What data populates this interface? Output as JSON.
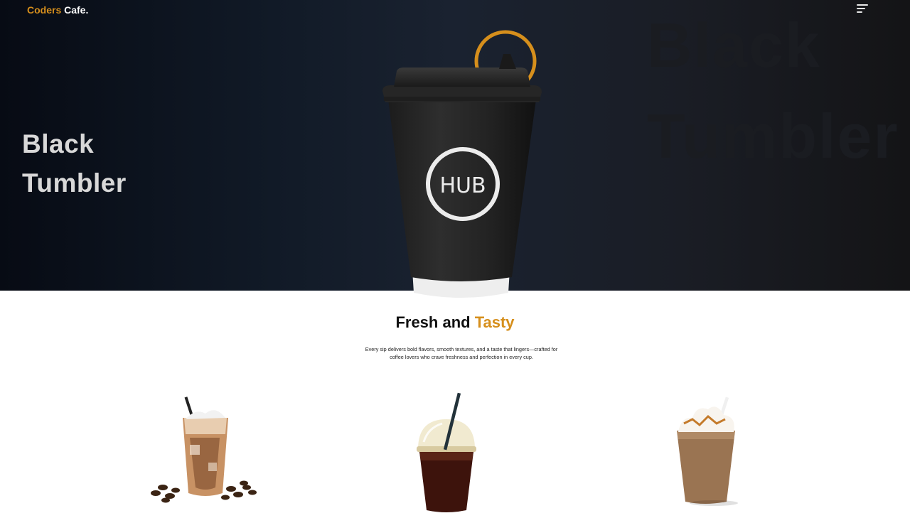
{
  "header": {
    "logo_first": "Coders",
    "logo_second": "Cafe.",
    "menu_icon": "hamburger-menu-icon"
  },
  "hero": {
    "title_line1": "Black",
    "title_line2": "Tumbler",
    "bg_line1": "Black",
    "bg_line2": "Tumbler",
    "cup_brand": "HUB"
  },
  "section": {
    "title_main": "Fresh and",
    "title_accent": "Tasty",
    "description": "Every sip delivers bold flavors, smooth textures, and a taste that lingers—crafted for coffee lovers who crave freshness and perfection in every cup."
  },
  "products": [
    {
      "icon": "iced-latte-image"
    },
    {
      "icon": "iced-americano-image"
    },
    {
      "icon": "caramel-frappe-image"
    }
  ],
  "colors": {
    "accent": "#d68f1c",
    "hero_bg": "#111a27",
    "text_dark": "#111111"
  }
}
